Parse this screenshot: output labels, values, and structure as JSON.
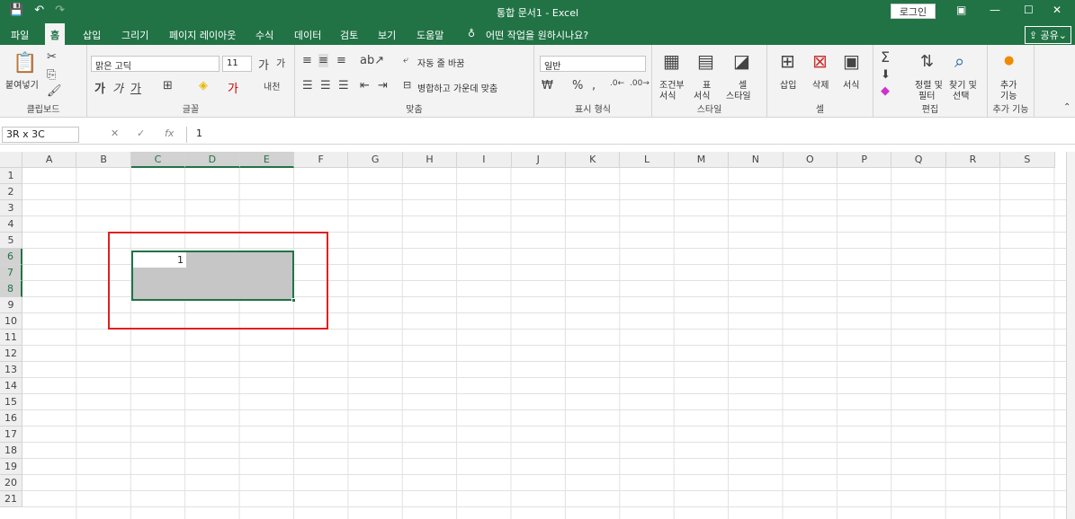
{
  "window": {
    "title": "통합 문서1  -  Excel",
    "login": "로그인"
  },
  "tabs": [
    "파일",
    "홈",
    "삽입",
    "그리기",
    "페이지 레이아웃",
    "수식",
    "데이터",
    "검토",
    "보기",
    "도움말"
  ],
  "tellme": "어떤 작업을 원하시나요?",
  "share": "공유",
  "ribbon": {
    "paste": "붙여넣기",
    "clipboard": "클립보드",
    "font_name": "맑은 고딕",
    "font_size": "11",
    "font": "글꼴",
    "wrap": "자동 줄 바꿈",
    "merge": "병합하고 가운데 맞춤",
    "align": "맞춤",
    "number_format": "일반",
    "number": "표시 형식",
    "cond_format": "조건부",
    "cond_format2": "서식",
    "table_format": "표",
    "table_format2": "서식",
    "cell_style": "셀",
    "cell_style2": "스타일",
    "styles": "스타일",
    "insert": "삽입",
    "delete": "삭제",
    "format": "서식",
    "cells": "셀",
    "sort": "정렬 및",
    "sort2": "필터",
    "find": "찾기 및",
    "find2": "선택",
    "editing": "편집",
    "addins_btn": "추가",
    "addins_btn2": "기능",
    "addins": "추가 기능"
  },
  "formula": {
    "namebox": "3R x 3C",
    "value": "1"
  },
  "columns": [
    "A",
    "B",
    "C",
    "D",
    "E",
    "F",
    "G",
    "H",
    "I",
    "J",
    "K",
    "L",
    "M",
    "N",
    "O",
    "P",
    "Q",
    "R",
    "S"
  ],
  "rows": [
    "1",
    "2",
    "3",
    "4",
    "5",
    "6",
    "7",
    "8",
    "9",
    "10",
    "11",
    "12",
    "13",
    "14",
    "15",
    "16",
    "17",
    "18",
    "19",
    "20",
    "21"
  ],
  "cell_C6": "1"
}
